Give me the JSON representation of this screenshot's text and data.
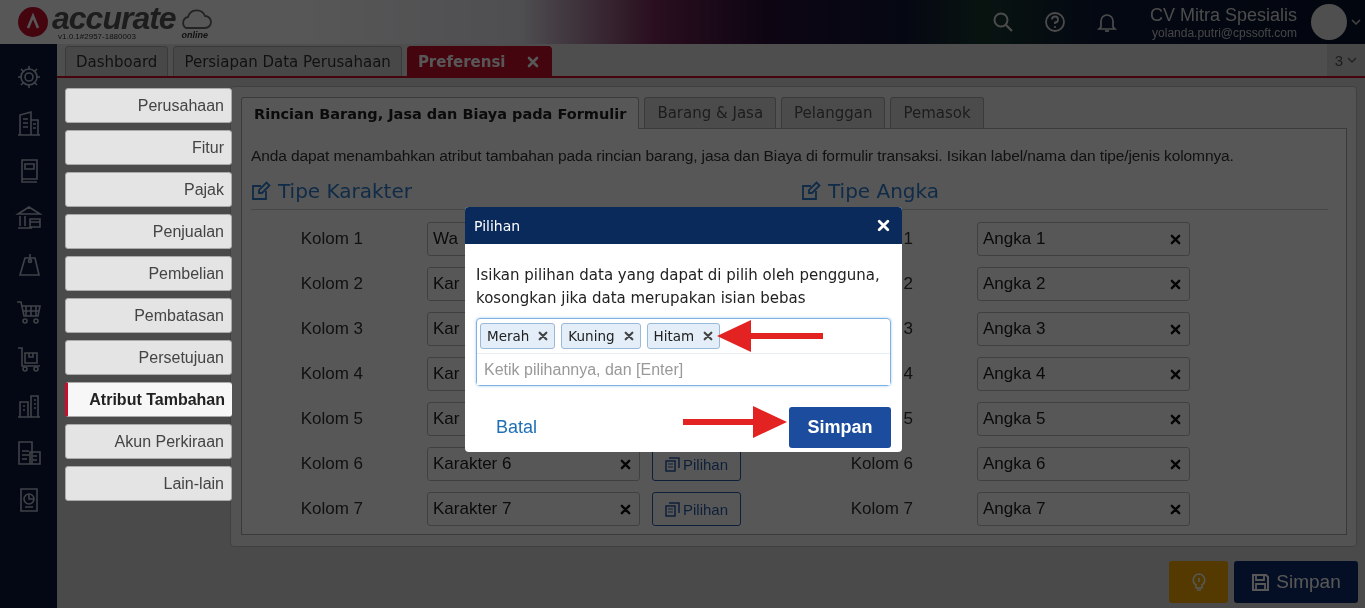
{
  "app": {
    "logo": "accurate",
    "logo_sub": "online",
    "version": "v1.0.1#2957-1880003"
  },
  "header": {
    "company": "CV Mitra Spesialis",
    "email": "yolanda.putri@cpssoft.com"
  },
  "doc_tabs": [
    {
      "label": "Dashboard",
      "selected": false,
      "closable": false
    },
    {
      "label": "Persiapan Data Perusahaan",
      "selected": false,
      "closable": false
    },
    {
      "label": "Preferensi",
      "selected": true,
      "closable": true
    }
  ],
  "tab_count": "3",
  "settings_menu": [
    {
      "label": "Perusahaan",
      "selected": false
    },
    {
      "label": "Fitur",
      "selected": false
    },
    {
      "label": "Pajak",
      "selected": false
    },
    {
      "label": "Penjualan",
      "selected": false
    },
    {
      "label": "Pembelian",
      "selected": false
    },
    {
      "label": "Pembatasan",
      "selected": false
    },
    {
      "label": "Persetujuan",
      "selected": false
    },
    {
      "label": "Atribut Tambahan",
      "selected": true
    },
    {
      "label": "Akun Perkiraan",
      "selected": false
    },
    {
      "label": "Lain-lain",
      "selected": false
    }
  ],
  "form_tabs": [
    {
      "label": "Rincian Barang, Jasa dan Biaya pada Formulir",
      "selected": true
    },
    {
      "label": "Barang & Jasa",
      "selected": false
    },
    {
      "label": "Pelanggan",
      "selected": false
    },
    {
      "label": "Pemasok",
      "selected": false
    }
  ],
  "description": "Anda dapat menambahkan atribut tambahan pada rincian barang, jasa dan Biaya di formulir transaksi. Isikan label/nama dan tipe/jenis kolomnya.",
  "sections": [
    {
      "title": "Tipe Karakter",
      "rows": [
        {
          "label": "Kolom 1",
          "value": "Wa"
        },
        {
          "label": "Kolom 2",
          "value": "Kar"
        },
        {
          "label": "Kolom 3",
          "value": "Kar"
        },
        {
          "label": "Kolom 4",
          "value": "Kar"
        },
        {
          "label": "Kolom 5",
          "value": "Kar"
        },
        {
          "label": "Kolom 6",
          "value": "Karakter 6",
          "clearable": true,
          "options_button": "Pilihan"
        },
        {
          "label": "Kolom 7",
          "value": "Karakter 7",
          "clearable": true,
          "options_button": "Pilihan"
        }
      ]
    },
    {
      "title": "Tipe Angka",
      "rows": [
        {
          "label": "1",
          "value": "Angka 1",
          "clearable": true
        },
        {
          "label": "2",
          "value": "Angka 2",
          "clearable": true
        },
        {
          "label": "3",
          "value": "Angka 3",
          "clearable": true
        },
        {
          "label": "4",
          "value": "Angka 4",
          "clearable": true
        },
        {
          "label": "5",
          "value": "Angka 5",
          "clearable": true
        },
        {
          "label": "Kolom 6",
          "value": "Angka 6",
          "clearable": true
        },
        {
          "label": "Kolom 7",
          "value": "Angka 7",
          "clearable": true
        }
      ]
    }
  ],
  "footer": {
    "save_button": "Simpan"
  },
  "dialog": {
    "title": "Pilihan",
    "message": "Isikan pilihan data yang dapat di pilih oleh pengguna, kosongkan jika data merupakan isian bebas",
    "tags": [
      "Merah",
      "Kuning",
      "Hitam"
    ],
    "placeholder": "Ketik pilihannya, dan [Enter]",
    "cancel": "Batal",
    "save": "Simpan"
  }
}
